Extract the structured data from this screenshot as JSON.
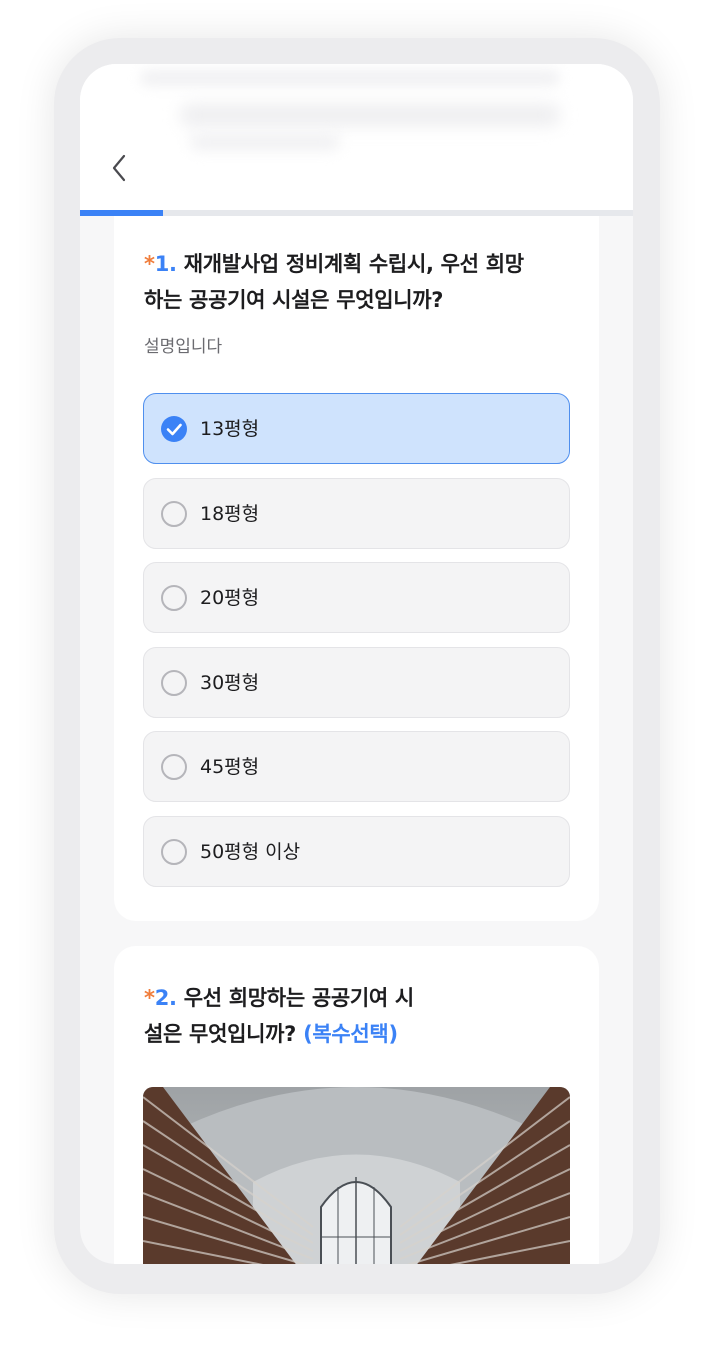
{
  "progress": {
    "fraction": 0.15
  },
  "question1": {
    "required_mark": "*",
    "number": "1.",
    "title_line1": "재개발사업 정비계획 수립시, 우선 희망",
    "title_line2": "하는 공공기여 시설은 무엇입니까?",
    "description": "설명입니다",
    "options": [
      {
        "label": "13평형",
        "selected": true
      },
      {
        "label": "18평형",
        "selected": false
      },
      {
        "label": "20평형",
        "selected": false
      },
      {
        "label": "30평형",
        "selected": false
      },
      {
        "label": "45평형",
        "selected": false
      },
      {
        "label": "50평형 이상",
        "selected": false
      }
    ]
  },
  "question2": {
    "required_mark": "*",
    "number": "2.",
    "title_line1": "우선 희망하는 공공기여 시",
    "title_line2": "설은 무엇입니까?",
    "multi_label": "(복수선택)"
  },
  "colors": {
    "accent": "#3b82f6",
    "required": "#f07d3b",
    "selected_bg": "#cfe3fd"
  },
  "icons": {
    "back": "chevron-left-icon",
    "checked": "check-circle-icon",
    "unchecked": "radio-empty-icon"
  }
}
